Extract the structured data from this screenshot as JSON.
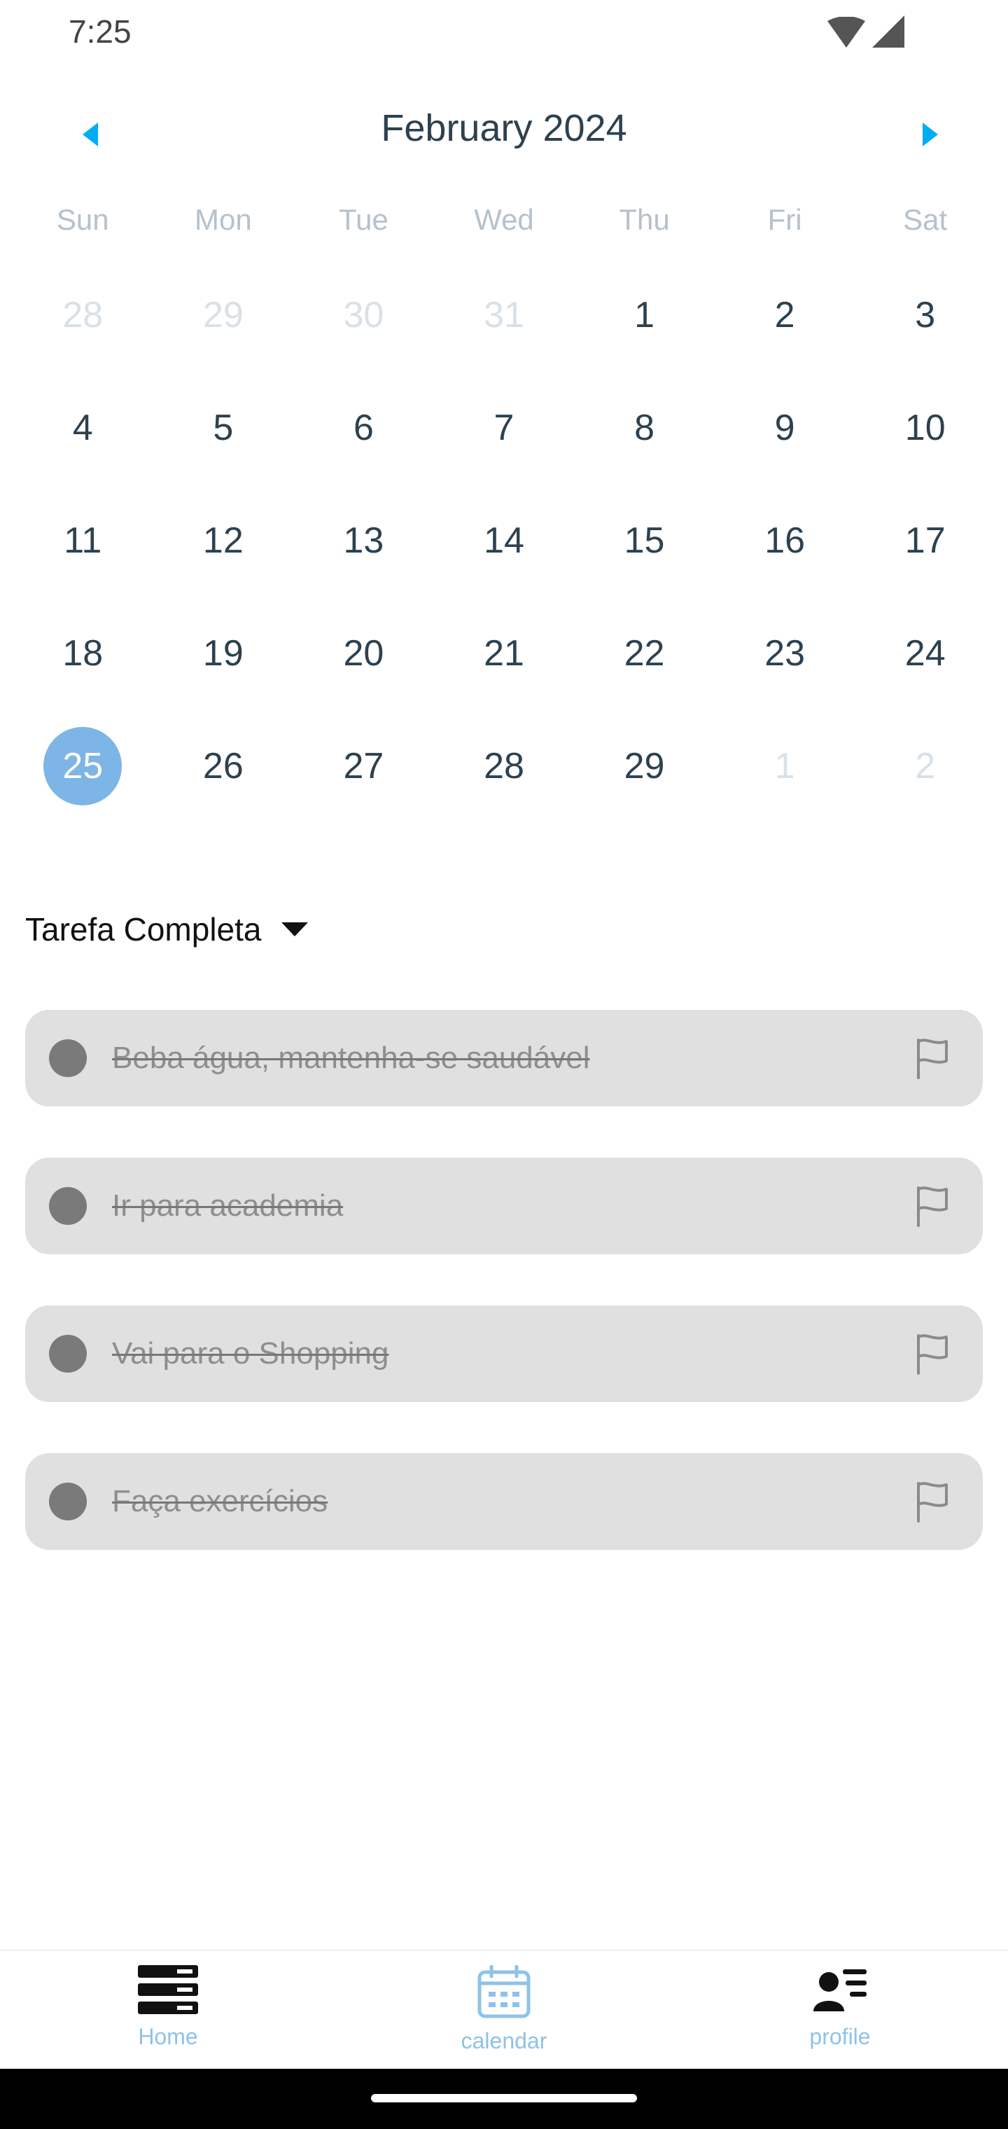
{
  "status_bar": {
    "time": "7:25",
    "icons": [
      "wifi-icon",
      "cell-signal-icon"
    ]
  },
  "calendar": {
    "month_title": "February 2024",
    "prev_icon": "chevron-left-icon",
    "next_icon": "chevron-right-icon",
    "accent_color": "#00adf5",
    "selected_color": "#7cb5e6",
    "weekdays": [
      "Sun",
      "Mon",
      "Tue",
      "Wed",
      "Thu",
      "Fri",
      "Sat"
    ],
    "days": [
      {
        "label": "28",
        "state": "muted"
      },
      {
        "label": "29",
        "state": "muted"
      },
      {
        "label": "30",
        "state": "muted"
      },
      {
        "label": "31",
        "state": "muted"
      },
      {
        "label": "1",
        "state": "normal"
      },
      {
        "label": "2",
        "state": "normal"
      },
      {
        "label": "3",
        "state": "normal"
      },
      {
        "label": "4",
        "state": "normal"
      },
      {
        "label": "5",
        "state": "normal"
      },
      {
        "label": "6",
        "state": "normal"
      },
      {
        "label": "7",
        "state": "normal"
      },
      {
        "label": "8",
        "state": "normal"
      },
      {
        "label": "9",
        "state": "normal"
      },
      {
        "label": "10",
        "state": "normal"
      },
      {
        "label": "11",
        "state": "normal"
      },
      {
        "label": "12",
        "state": "normal"
      },
      {
        "label": "13",
        "state": "normal"
      },
      {
        "label": "14",
        "state": "normal"
      },
      {
        "label": "15",
        "state": "normal"
      },
      {
        "label": "16",
        "state": "normal"
      },
      {
        "label": "17",
        "state": "normal"
      },
      {
        "label": "18",
        "state": "normal"
      },
      {
        "label": "19",
        "state": "normal"
      },
      {
        "label": "20",
        "state": "normal"
      },
      {
        "label": "21",
        "state": "normal"
      },
      {
        "label": "22",
        "state": "normal"
      },
      {
        "label": "23",
        "state": "normal"
      },
      {
        "label": "24",
        "state": "normal"
      },
      {
        "label": "25",
        "state": "selected"
      },
      {
        "label": "26",
        "state": "normal"
      },
      {
        "label": "27",
        "state": "normal"
      },
      {
        "label": "28",
        "state": "normal"
      },
      {
        "label": "29",
        "state": "normal"
      },
      {
        "label": "1",
        "state": "muted"
      },
      {
        "label": "2",
        "state": "muted"
      }
    ]
  },
  "filter": {
    "label": "Tarefa Completa",
    "icon": "caret-down-icon"
  },
  "tasks": [
    {
      "text": "Beba água, mantenha-se saudável",
      "completed": true,
      "icon": "flag-icon"
    },
    {
      "text": "Ir para academia",
      "completed": true,
      "icon": "flag-icon"
    },
    {
      "text": "Vai para o Shopping",
      "completed": true,
      "icon": "flag-icon"
    },
    {
      "text": "Faça exercícios",
      "completed": true,
      "icon": "flag-icon"
    }
  ],
  "bottom_nav": {
    "active_color": "#8ec2ea",
    "items": [
      {
        "label": "Home",
        "icon": "stack-icon"
      },
      {
        "label": "calendar",
        "icon": "calendar-icon"
      },
      {
        "label": "profile",
        "icon": "person-list-icon"
      }
    ]
  }
}
